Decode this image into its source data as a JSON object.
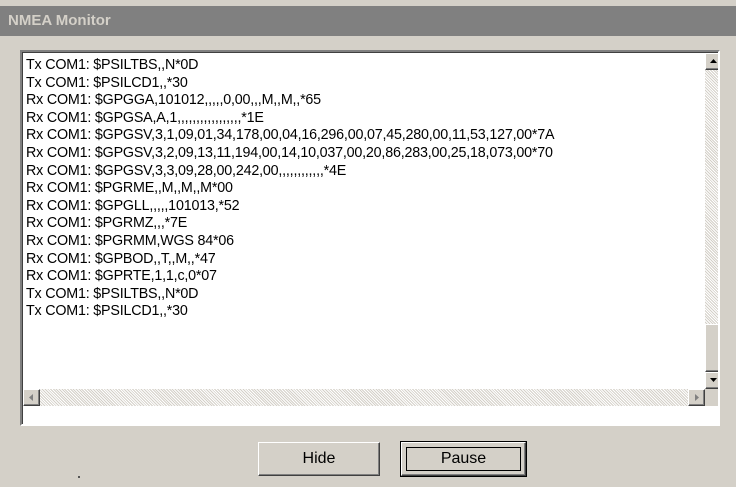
{
  "window": {
    "title": "NMEA Monitor"
  },
  "log": {
    "lines": [
      "Tx COM1: $PSILTBS,,N*0D",
      "Tx COM1: $PSILCD1,,*30",
      "Rx COM1: $GPGGA,101012,,,,,0,00,,,M,,M,,*65",
      "Rx COM1: $GPGSA,A,1,,,,,,,,,,,,,,,,,*1E",
      "Rx COM1: $GPGSV,3,1,09,01,34,178,00,04,16,296,00,07,45,280,00,11,53,127,00*7A",
      "Rx COM1: $GPGSV,3,2,09,13,11,194,00,14,10,037,00,20,86,283,00,25,18,073,00*70",
      "Rx COM1: $GPGSV,3,3,09,28,00,242,00,,,,,,,,,,,,*4E",
      "Rx COM1: $PGRME,,M,,M,,M*00",
      "Rx COM1: $GPGLL,,,,,101013,*52",
      "Rx COM1: $PGRMZ,,,*7E",
      "Rx COM1: $PGRMM,WGS 84*06",
      "Rx COM1: $GPBOD,,T,,M,,*47",
      "Rx COM1: $GPRTE,1,1,c,0*07",
      "Tx COM1: $PSILTBS,,N*0D",
      "Tx COM1: $PSILCD1,,*30"
    ]
  },
  "scrollbars": {
    "up_icon": "arrow-up-icon",
    "down_icon": "arrow-down-icon",
    "left_icon": "arrow-left-icon",
    "right_icon": "arrow-right-icon"
  },
  "buttons": {
    "hide_label": "Hide",
    "pause_label": "Pause"
  },
  "colors": {
    "titlebar": "#808080",
    "title_text": "#d4d0c8",
    "face": "#d4d0c8",
    "log_background": "#ffffff"
  }
}
